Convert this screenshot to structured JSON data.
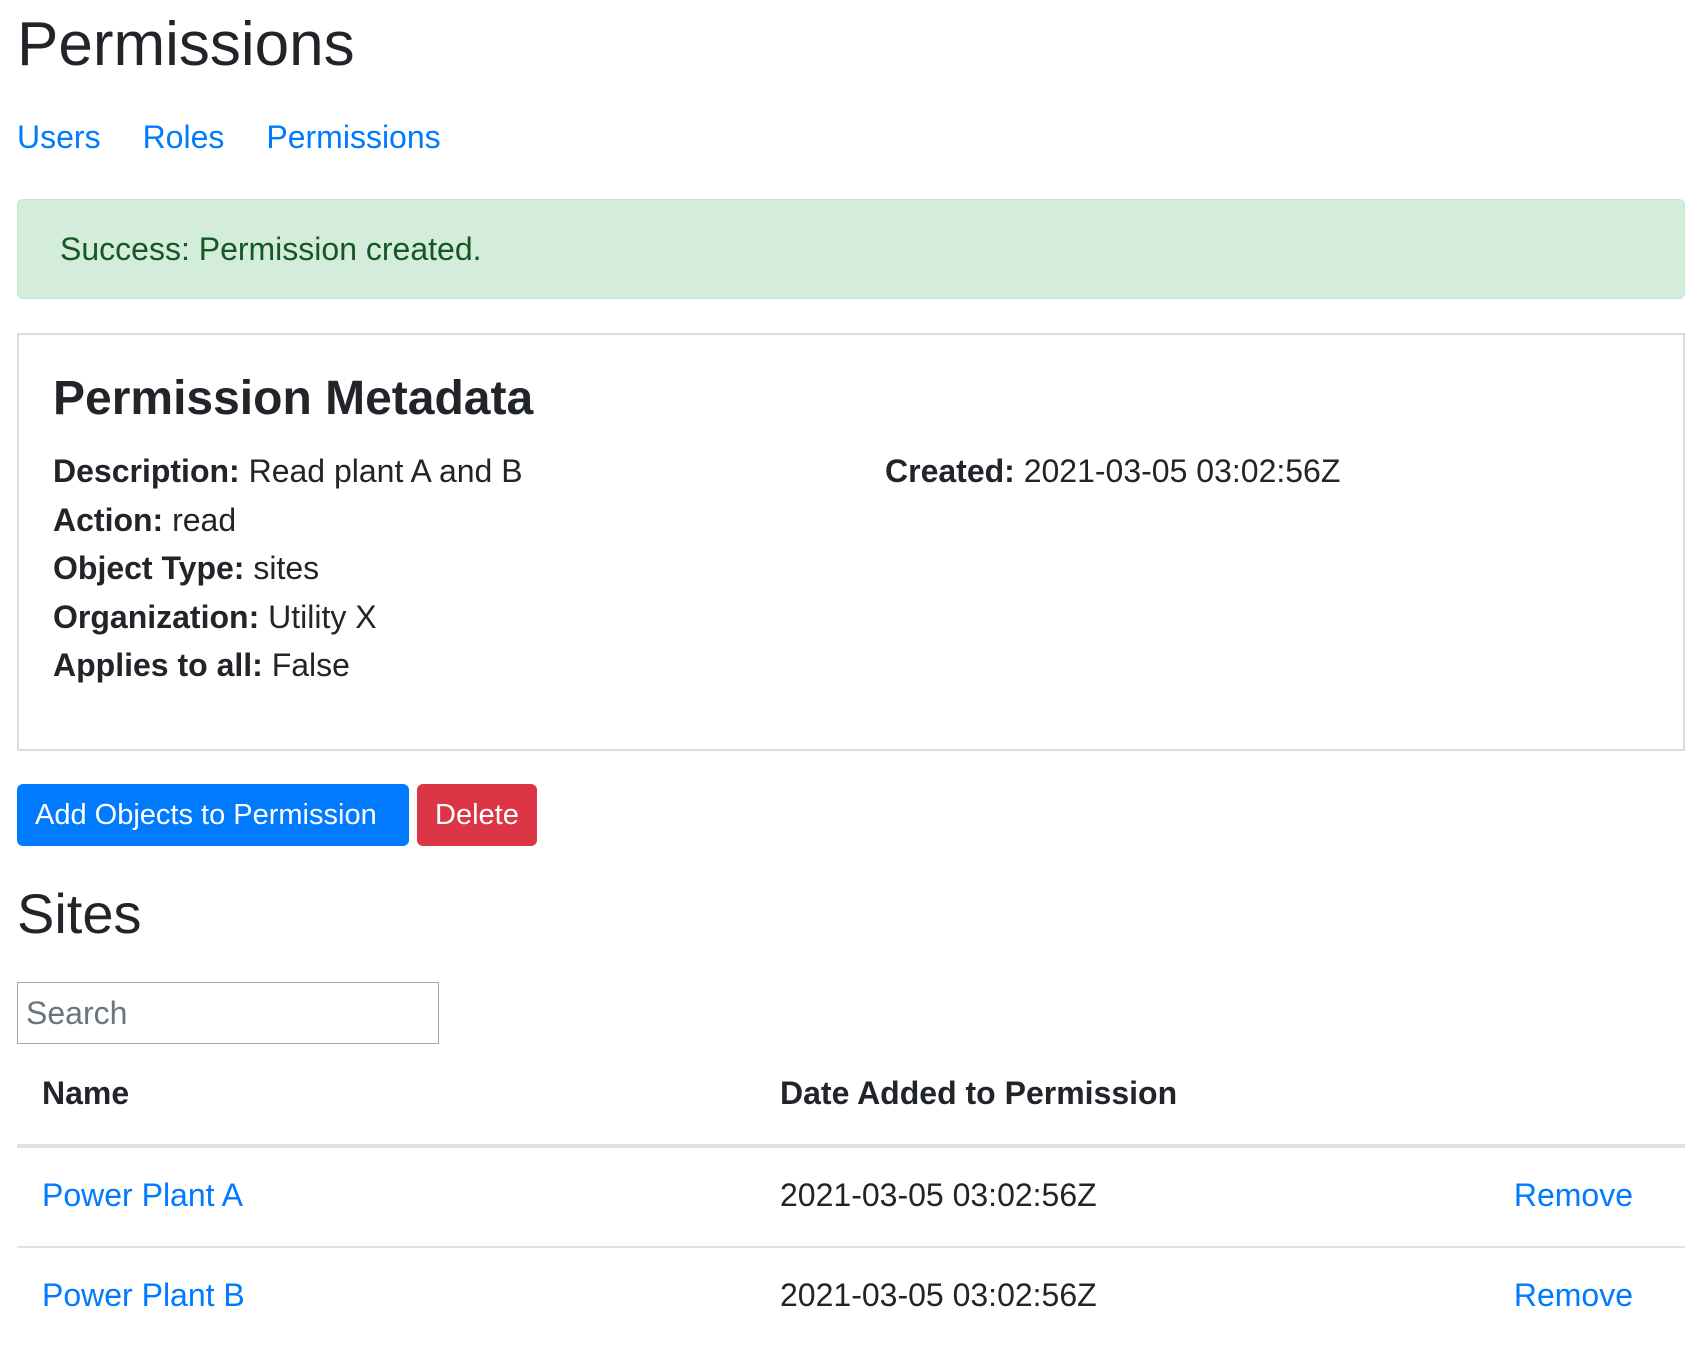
{
  "page": {
    "title": "Permissions"
  },
  "nav": {
    "items": [
      {
        "label": "Users"
      },
      {
        "label": "Roles"
      },
      {
        "label": "Permissions"
      }
    ]
  },
  "alert": {
    "message": "Success: Permission created."
  },
  "metadata": {
    "heading": "Permission Metadata",
    "fields": [
      {
        "label": "Description:",
        "value": "Read plant A and B"
      },
      {
        "label": "Action:",
        "value": "read"
      },
      {
        "label": "Object Type:",
        "value": "sites"
      },
      {
        "label": "Organization:",
        "value": "Utility X"
      },
      {
        "label": "Applies to all:",
        "value": "False"
      }
    ],
    "created": {
      "label": "Created:",
      "value": "2021-03-05 03:02:56Z"
    }
  },
  "actions": {
    "add_label": "Add Objects to Permission",
    "delete_label": "Delete"
  },
  "sites": {
    "heading": "Sites",
    "search_placeholder": "Search",
    "columns": {
      "name": "Name",
      "date": "Date Added to Permission"
    },
    "rows": [
      {
        "name": "Power Plant A",
        "date": "2021-03-05 03:02:56Z",
        "action": "Remove"
      },
      {
        "name": "Power Plant B",
        "date": "2021-03-05 03:02:56Z",
        "action": "Remove"
      }
    ]
  },
  "colors": {
    "link": "#007bff",
    "success_bg": "#d4edda",
    "success_text": "#155724",
    "primary": "#007bff",
    "danger": "#dc3545"
  }
}
